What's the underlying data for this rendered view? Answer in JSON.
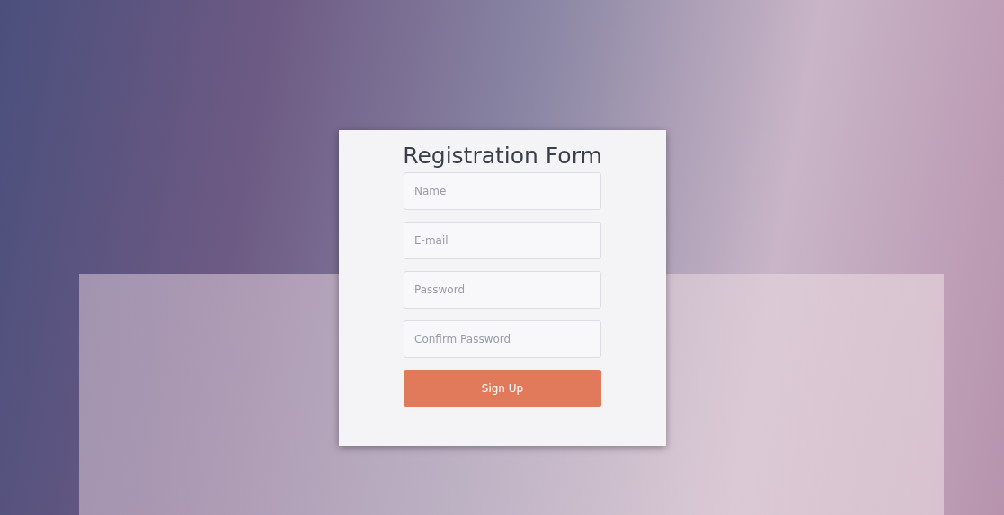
{
  "form": {
    "title": "Registration Form",
    "fields": [
      {
        "placeholder": "Name"
      },
      {
        "placeholder": "E-mail"
      },
      {
        "placeholder": "Password"
      },
      {
        "placeholder": "Confirm Password"
      }
    ],
    "submit": "Sign Up"
  }
}
